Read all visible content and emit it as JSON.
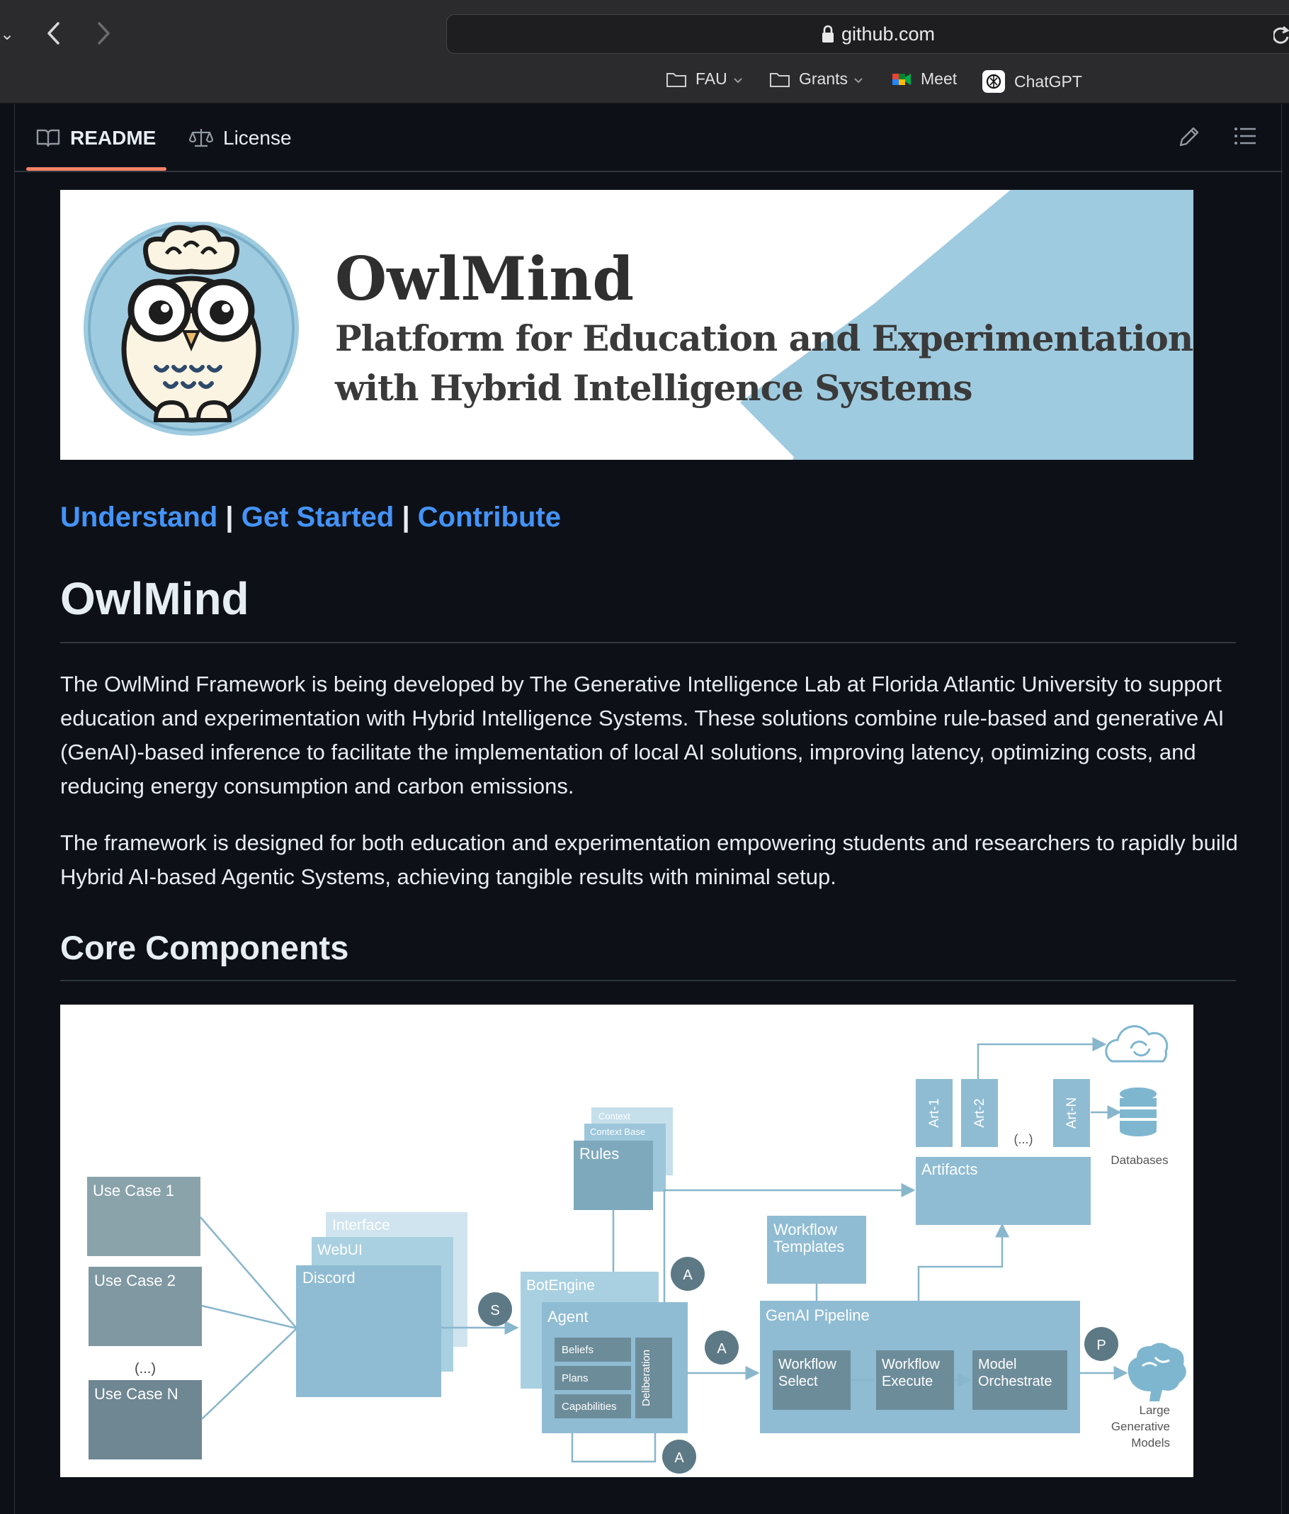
{
  "browser": {
    "url": "github.com",
    "bookmarks": [
      {
        "label": "FAU",
        "has_dropdown": true,
        "icon": "folder-icon"
      },
      {
        "label": "Grants",
        "has_dropdown": true,
        "icon": "folder-icon"
      },
      {
        "label": "Meet",
        "has_dropdown": false,
        "icon": "google-meet-icon"
      },
      {
        "label": "ChatGPT",
        "has_dropdown": false,
        "icon": "chatgpt-icon"
      }
    ]
  },
  "tabs": {
    "readme": "README",
    "license": "License"
  },
  "banner": {
    "title": "OwlMind",
    "subtitle_line1": "Platform for Education and Experimentation",
    "subtitle_line2": "with Hybrid Intelligence Systems"
  },
  "links": {
    "understand": "Understand",
    "get_started": "Get Started",
    "contribute": "Contribute",
    "separator": "|"
  },
  "content": {
    "title": "OwlMind",
    "paragraph1": "The OwlMind Framework is being developed by The Generative Intelligence Lab at Florida Atlantic University to support education and experimentation with Hybrid Intelligence Systems. These solutions combine rule-based and generative AI (GenAI)-based inference to facilitate the implementation of local AI solutions, improving latency, optimizing costs, and reducing energy consumption and carbon emissions.",
    "paragraph2": "The framework is designed for both education and experimentation empowering students and researchers to rapidly build Hybrid AI-based Agentic Systems, achieving tangible results with minimal setup.",
    "section_title": "Core Components"
  },
  "diagram": {
    "use_cases": [
      "Use Case 1",
      "Use Case 2",
      "(...)",
      "Use Case N"
    ],
    "interfaces": [
      "Interface",
      "WebUI",
      "Discord"
    ],
    "context": [
      "Context",
      "Context Base",
      "Rules"
    ],
    "botengine": "BotEngine",
    "agent": "Agent",
    "agent_parts": [
      "Beliefs",
      "Plans",
      "Capabilities"
    ],
    "deliberation": "Deliberation",
    "markers": {
      "s": "S",
      "a": "A",
      "p": "P"
    },
    "workflow_templates": "Workflow Templates",
    "genai_pipeline": "GenAI Pipeline",
    "pipeline_steps": [
      "Workflow Select",
      "Workflow Execute",
      "Model Orchestrate"
    ],
    "artifacts": "Artifacts",
    "artifact_items": [
      "Art-1",
      "Art-2",
      "(...)",
      "Art-N"
    ],
    "databases": "Databases",
    "models": "Large Generative Models"
  }
}
